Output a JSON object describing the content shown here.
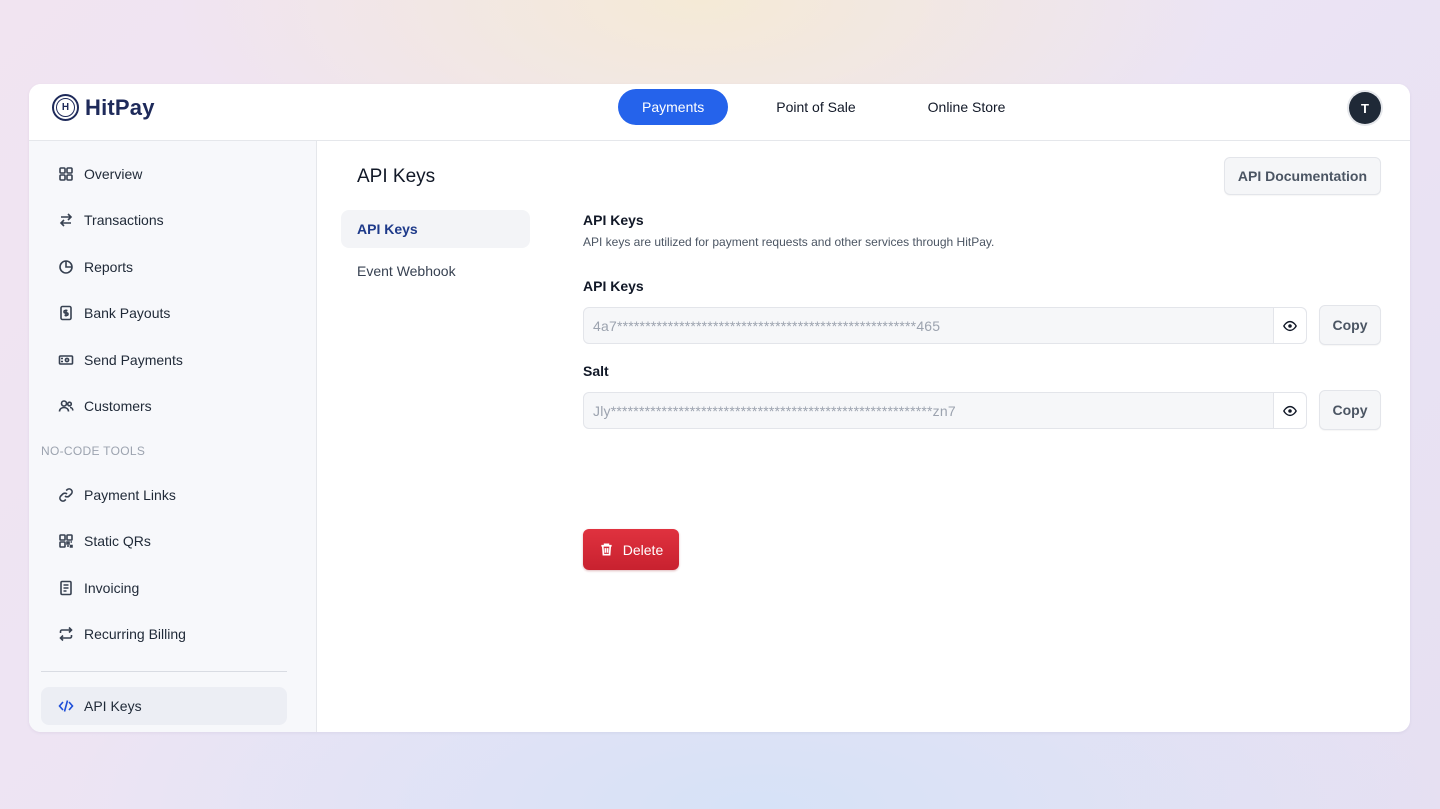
{
  "brand": {
    "name": "HitPay",
    "mark_letter": "H"
  },
  "topnav": {
    "tabs": [
      {
        "label": "Payments",
        "active": true
      },
      {
        "label": "Point of Sale",
        "active": false
      },
      {
        "label": "Online Store",
        "active": false
      }
    ],
    "avatar_initial": "T"
  },
  "sidebar": {
    "items": [
      {
        "label": "Overview",
        "icon": "grid-icon"
      },
      {
        "label": "Transactions",
        "icon": "arrows-swap-icon"
      },
      {
        "label": "Reports",
        "icon": "pie-chart-icon"
      },
      {
        "label": "Bank Payouts",
        "icon": "dollar-doc-icon"
      },
      {
        "label": "Send Payments",
        "icon": "cash-icon"
      },
      {
        "label": "Customers",
        "icon": "users-icon"
      }
    ],
    "section_label": "NO-CODE TOOLS",
    "tools": [
      {
        "label": "Payment Links",
        "icon": "link-icon"
      },
      {
        "label": "Static QRs",
        "icon": "qr-icon"
      },
      {
        "label": "Invoicing",
        "icon": "invoice-icon"
      },
      {
        "label": "Recurring Billing",
        "icon": "repeat-icon"
      }
    ],
    "bottom_item": {
      "label": "API Keys",
      "icon": "code-icon",
      "active": true
    }
  },
  "page": {
    "title": "API Keys",
    "doc_button": "API Documentation",
    "subnav": [
      {
        "label": "API Keys",
        "active": true
      },
      {
        "label": "Event Webhook",
        "active": false
      }
    ],
    "section_title": "API Keys",
    "section_desc": "API keys are utilized for payment requests and other services through HitPay.",
    "fields": [
      {
        "label": "API Keys",
        "value": "4a7*****************************************************465",
        "copy": "Copy"
      },
      {
        "label": "Salt",
        "value": "Jly*********************************************************zn7",
        "copy": "Copy"
      }
    ],
    "delete_button": "Delete"
  },
  "colors": {
    "accent": "#2563eb",
    "danger": "#d72836",
    "brand": "#1e2a5a"
  }
}
